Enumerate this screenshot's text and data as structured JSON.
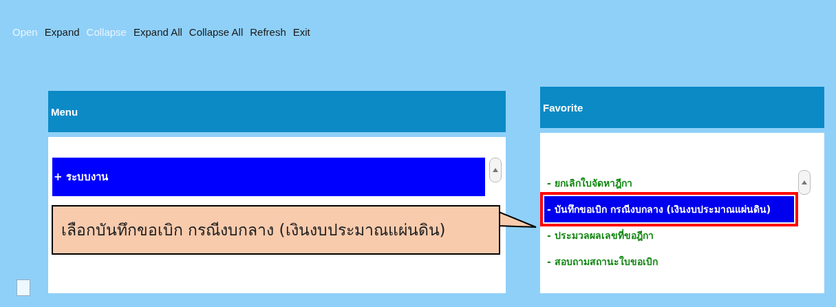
{
  "toolbar": [
    {
      "label": "Open",
      "disabled": true
    },
    {
      "label": "Expand",
      "disabled": false
    },
    {
      "label": "Collapse",
      "disabled": true
    },
    {
      "label": "Expand All",
      "disabled": false
    },
    {
      "label": "Collapse All",
      "disabled": false
    },
    {
      "label": "Refresh",
      "disabled": false
    },
    {
      "label": "Exit",
      "disabled": false
    }
  ],
  "menu": {
    "title": "Menu",
    "items": [
      {
        "label": "+ ระบบงาน",
        "selected": true
      }
    ]
  },
  "favorite": {
    "title": "Favorite",
    "items": [
      {
        "label": "- ยกเลิกใบจัดหาฎีกา",
        "selected": false,
        "outlined": false
      },
      {
        "label": "- บันทึกขอเบิก กรณีงบกลาง (เงินงบประมาณแผ่นดิน)",
        "selected": true,
        "outlined": true
      },
      {
        "label": "- ประมวลผลเลขที่ขอฎีกา",
        "selected": false,
        "outlined": false
      },
      {
        "label": "- สอบถามสถานะใบขอเบิก",
        "selected": false,
        "outlined": false
      }
    ]
  },
  "callout": {
    "text": "เลือกบันทึกขอเบิก กรณีงบกลาง (เงินงบประมาณแผ่นดิน)"
  }
}
